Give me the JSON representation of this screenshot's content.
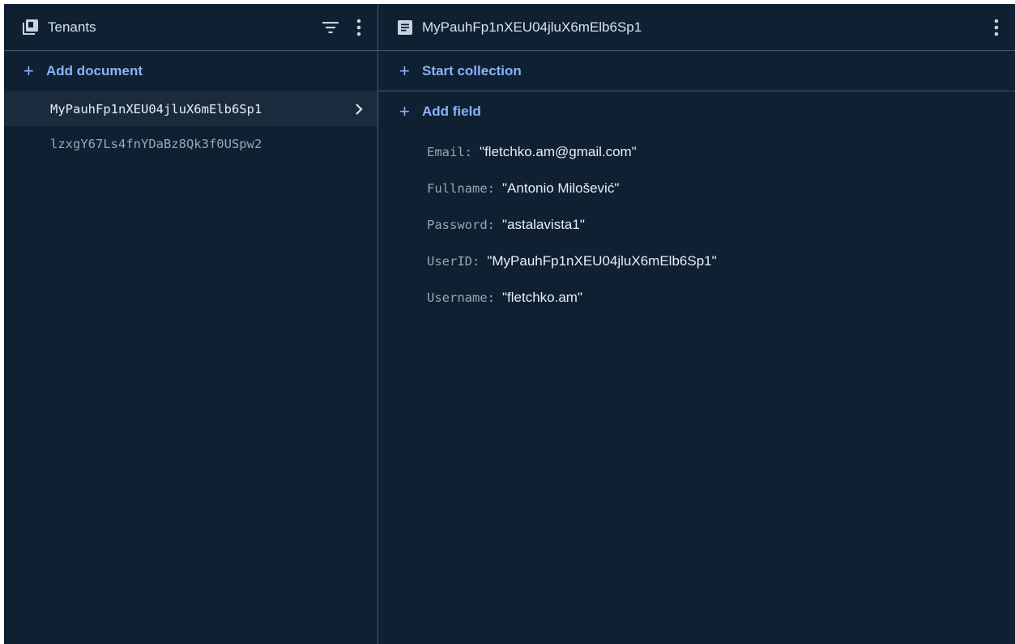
{
  "collection_panel": {
    "title": "Tenants",
    "icon": "collection-icon",
    "add_document_label": "Add document",
    "documents": [
      {
        "id": "MyPauhFp1nXEU04jluX6mElb6Sp1",
        "selected": true
      },
      {
        "id": "lzxgY67Ls4fnYDaBz8Qk3f0USpw2",
        "selected": false
      }
    ]
  },
  "document_panel": {
    "title": "MyPauhFp1nXEU04jluX6mElb6Sp1",
    "icon": "document-icon",
    "start_collection_label": "Start collection",
    "add_field_label": "Add field",
    "fields": [
      {
        "key": "Email",
        "value": "fletchko.am@gmail.com"
      },
      {
        "key": "Fullname",
        "value": "Antonio Milošević"
      },
      {
        "key": "Password",
        "value": "astalavista1"
      },
      {
        "key": "UserID",
        "value": "MyPauhFp1nXEU04jluX6mElb6Sp1"
      },
      {
        "key": "Username",
        "value": "fletchko.am"
      }
    ]
  },
  "colors": {
    "background": "#0f2033",
    "accent": "#8ab4f8",
    "selected_row": "#1b2b3e",
    "divider": "#4b5a6b"
  }
}
